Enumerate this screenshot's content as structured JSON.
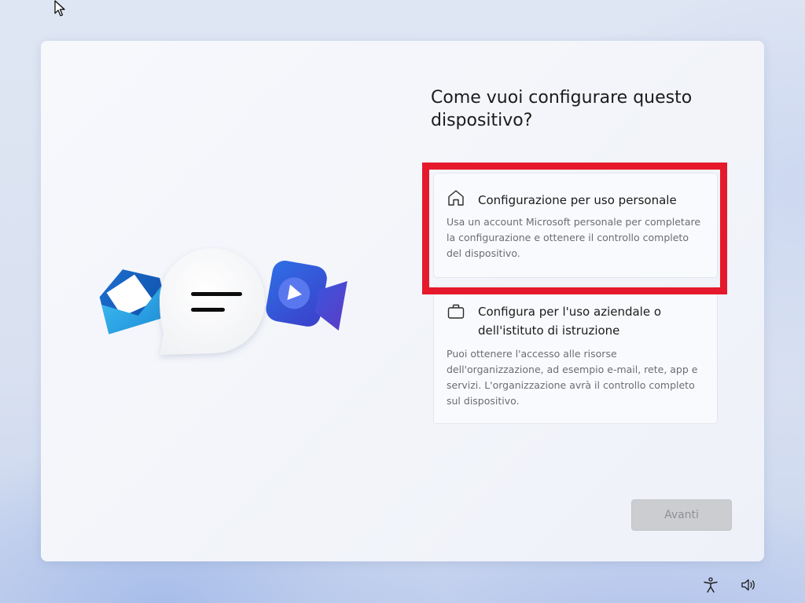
{
  "dialog": {
    "title": "Come vuoi configurare questo dispositivo?"
  },
  "options": [
    {
      "icon": "home-icon",
      "title": "Configurazione per uso personale",
      "description": "Usa un account Microsoft personale per completare la configurazione e ottenere il controllo completo del dispositivo.",
      "selected": true
    },
    {
      "icon": "briefcase-icon",
      "title": "Configura per l'uso aziendale o dell'istituto di istruzione",
      "description": "Puoi ottenere l'accesso alle risorse dell'organizzazione, ad esempio e-mail, rete, app e servizi. L'organizzazione avrà il controllo completo sul dispositivo.",
      "selected": false
    }
  ],
  "footer": {
    "next_label": "Avanti",
    "next_enabled": false
  },
  "tray": {
    "icons": [
      "accessibility-icon",
      "volume-icon"
    ]
  },
  "illustration": {
    "icons": [
      "mail-icon",
      "chat-bubble-icon",
      "video-icon"
    ]
  },
  "colors": {
    "highlight": "#e5192b",
    "mail_blue": "#2a9de0",
    "video_blue": "#3a4fd8"
  }
}
